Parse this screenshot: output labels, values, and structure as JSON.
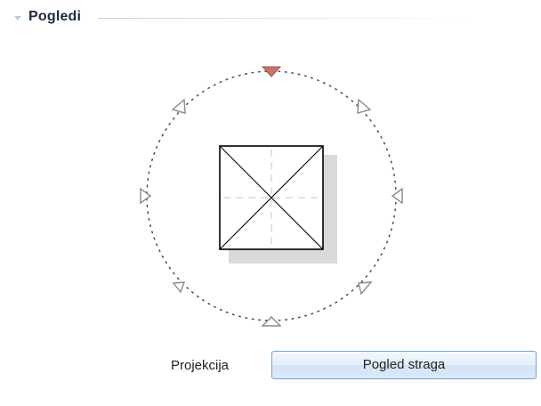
{
  "section": {
    "title": "Pogledi",
    "expanded": true,
    "toggle_icon": "triangle-down-icon"
  },
  "view_selector": {
    "markers": [
      {
        "position": "front",
        "icon": "triangle-down-icon",
        "active": true
      },
      {
        "position": "front-right",
        "icon": "triangle-icon",
        "active": false
      },
      {
        "position": "right",
        "icon": "triangle-left-icon",
        "active": false
      },
      {
        "position": "back-right",
        "icon": "triangle-icon",
        "active": false
      },
      {
        "position": "back",
        "icon": "triangle-up-icon",
        "active": false
      },
      {
        "position": "back-left",
        "icon": "triangle-icon",
        "active": false
      },
      {
        "position": "left",
        "icon": "triangle-right-icon",
        "active": false
      },
      {
        "position": "front-left",
        "icon": "triangle-icon",
        "active": false
      }
    ],
    "center_icon": "square-x-icon",
    "colors": {
      "active_marker": "#c9736e",
      "inactive_marker": "#8a8a8a",
      "shadow": "#d9d9d9"
    }
  },
  "projection": {
    "label": "Projekcija",
    "value": "Pogled straga"
  }
}
